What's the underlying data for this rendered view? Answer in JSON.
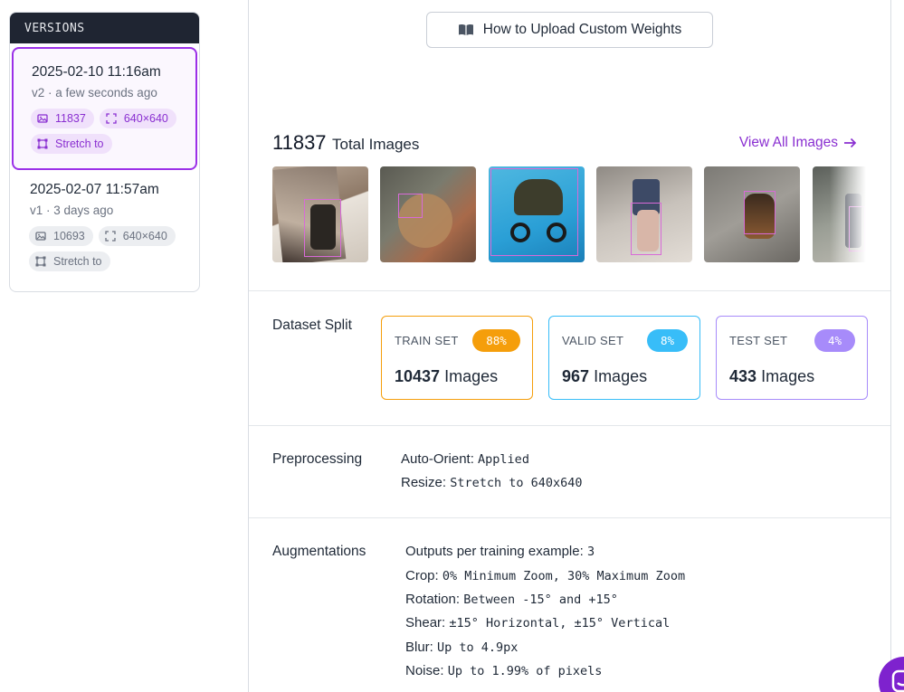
{
  "versions": {
    "header": "VERSIONS",
    "items": [
      {
        "title": "2025-02-10 11:16am",
        "subtitle": "v2 · a few seconds ago",
        "image_count": "11837",
        "size": "640×640",
        "resize": "Stretch to",
        "selected": true
      },
      {
        "title": "2025-02-07 11:57am",
        "subtitle": "v1 · 3 days ago",
        "image_count": "10693",
        "size": "640×640",
        "resize": "Stretch to",
        "selected": false
      }
    ]
  },
  "upload_button": {
    "label": "How to Upload Custom Weights",
    "icon": "book-icon"
  },
  "images": {
    "total_count": "11837",
    "total_label": "Total Images",
    "view_all": "View All Images"
  },
  "dataset_split": {
    "label": "Dataset Split",
    "sets": [
      {
        "name": "TRAIN SET",
        "percent": "88%",
        "count": "10437",
        "unit": "Images",
        "color": "#f59e0b"
      },
      {
        "name": "VALID SET",
        "percent": "8%",
        "count": "967",
        "unit": "Images",
        "color": "#38bdf8"
      },
      {
        "name": "TEST SET",
        "percent": "4%",
        "count": "433",
        "unit": "Images",
        "color": "#a78bfa"
      }
    ]
  },
  "preprocessing": {
    "label": "Preprocessing",
    "items": [
      {
        "key": "Auto-Orient:",
        "value": "Applied"
      },
      {
        "key": "Resize:",
        "value": "Stretch to 640x640"
      }
    ]
  },
  "augmentations": {
    "label": "Augmentations",
    "items": [
      {
        "key": "Outputs per training example:",
        "value": "3"
      },
      {
        "key": "Crop:",
        "value": "0% Minimum Zoom, 30% Maximum Zoom"
      },
      {
        "key": "Rotation:",
        "value": "Between -15° and +15°"
      },
      {
        "key": "Shear:",
        "value": "±15° Horizontal, ±15° Vertical"
      },
      {
        "key": "Blur:",
        "value": "Up to 4.9px"
      },
      {
        "key": "Noise:",
        "value": "Up to 1.99% of pixels"
      }
    ]
  },
  "colors": {
    "accent": "#8a2fd1",
    "sidebar_header": "#1f2532"
  }
}
